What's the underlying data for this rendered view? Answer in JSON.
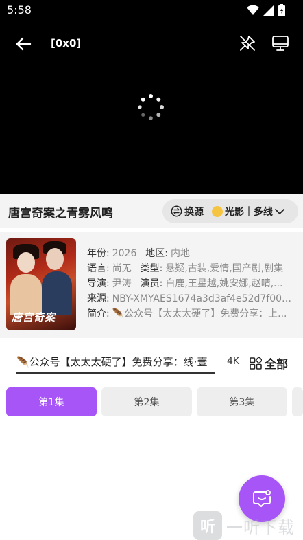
{
  "status": {
    "time": "5:58"
  },
  "player": {
    "title": "[0x0]"
  },
  "show": {
    "name": "唐宫奇案之青雾风鸣",
    "switch_source_label": "换源",
    "source_label": "光影｜多线",
    "poster_title": "唐宫奇案"
  },
  "details": {
    "year_label": "年份:",
    "year": "2026",
    "region_label": "地区:",
    "region": "内地",
    "language_label": "语言:",
    "language": "尚无",
    "genre_label": "类型:",
    "genre": "悬疑,古装,爱情,国产剧,剧集",
    "director_label": "导演:",
    "director": "尹涛",
    "cast_label": "演员:",
    "cast": "白鹿,王星越,姚安娜,赵晴,...",
    "source_label": "来源:",
    "source": "NBY-XMYAES1674a3d3af4e52d7f006c...",
    "intro_label": "简介:",
    "intro": "🪶公众号【太太太硬了】免费分享：上..."
  },
  "lines": {
    "notice": "🪶公众号【太太太硬了】免费分享：线·壹",
    "resolution": "4K",
    "all_label": "全部"
  },
  "episodes": [
    "第1集",
    "第2集",
    "第3集"
  ],
  "active_episode": 0,
  "watermark": {
    "logo": "听",
    "text": "一听下载"
  },
  "colors": {
    "accent": "#a855f7",
    "panel": "#f4f4f4"
  }
}
